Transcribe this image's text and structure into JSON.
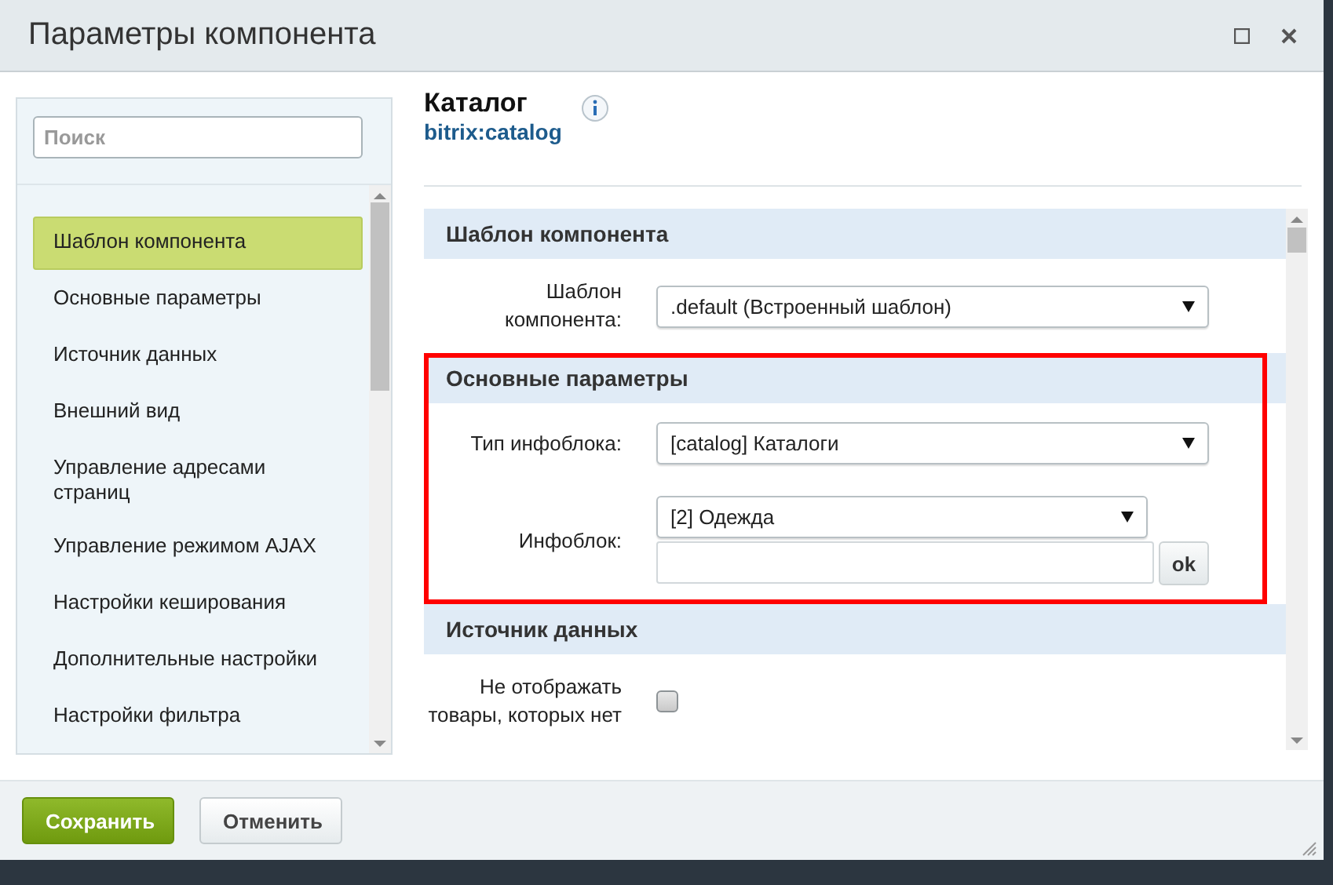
{
  "window": {
    "title": "Параметры компонента"
  },
  "sidebar": {
    "search": {
      "placeholder": "Поиск"
    },
    "items": [
      {
        "label": "Шаблон компонента",
        "selected": true
      },
      {
        "label": "Основные параметры",
        "selected": false
      },
      {
        "label": "Источник данных",
        "selected": false
      },
      {
        "label": "Внешний вид",
        "selected": false
      },
      {
        "label": "Управление адресами страниц",
        "selected": false
      },
      {
        "label": "Управление режимом AJAX",
        "selected": false
      },
      {
        "label": "Настройки кеширования",
        "selected": false
      },
      {
        "label": "Дополнительные настройки",
        "selected": false
      },
      {
        "label": "Настройки фильтра",
        "selected": false
      }
    ]
  },
  "component": {
    "title": "Каталог",
    "code": "bitrix:catalog"
  },
  "sections": [
    {
      "title": "Шаблон компонента",
      "highlighted": false,
      "fields": [
        {
          "kind": "select",
          "label": "Шаблон компонента:",
          "value": ".default (Встроенный шаблон)"
        }
      ]
    },
    {
      "title": "Основные параметры",
      "highlighted": true,
      "fields": [
        {
          "kind": "select",
          "label": "Тип инфоблока:",
          "value": "[catalog] Каталоги"
        },
        {
          "kind": "select_with_input",
          "label": "Инфоблок:",
          "value": "[2] Одежда",
          "button": "ok"
        }
      ]
    },
    {
      "title": "Источник данных",
      "highlighted": false,
      "fields": [
        {
          "kind": "checkbox",
          "label": "Не отображать товары, которых нет",
          "checked": false
        }
      ]
    }
  ],
  "buttons": [
    {
      "label": "Сохранить",
      "kind": "primary"
    },
    {
      "label": "Отменить",
      "kind": "secondary"
    }
  ]
}
